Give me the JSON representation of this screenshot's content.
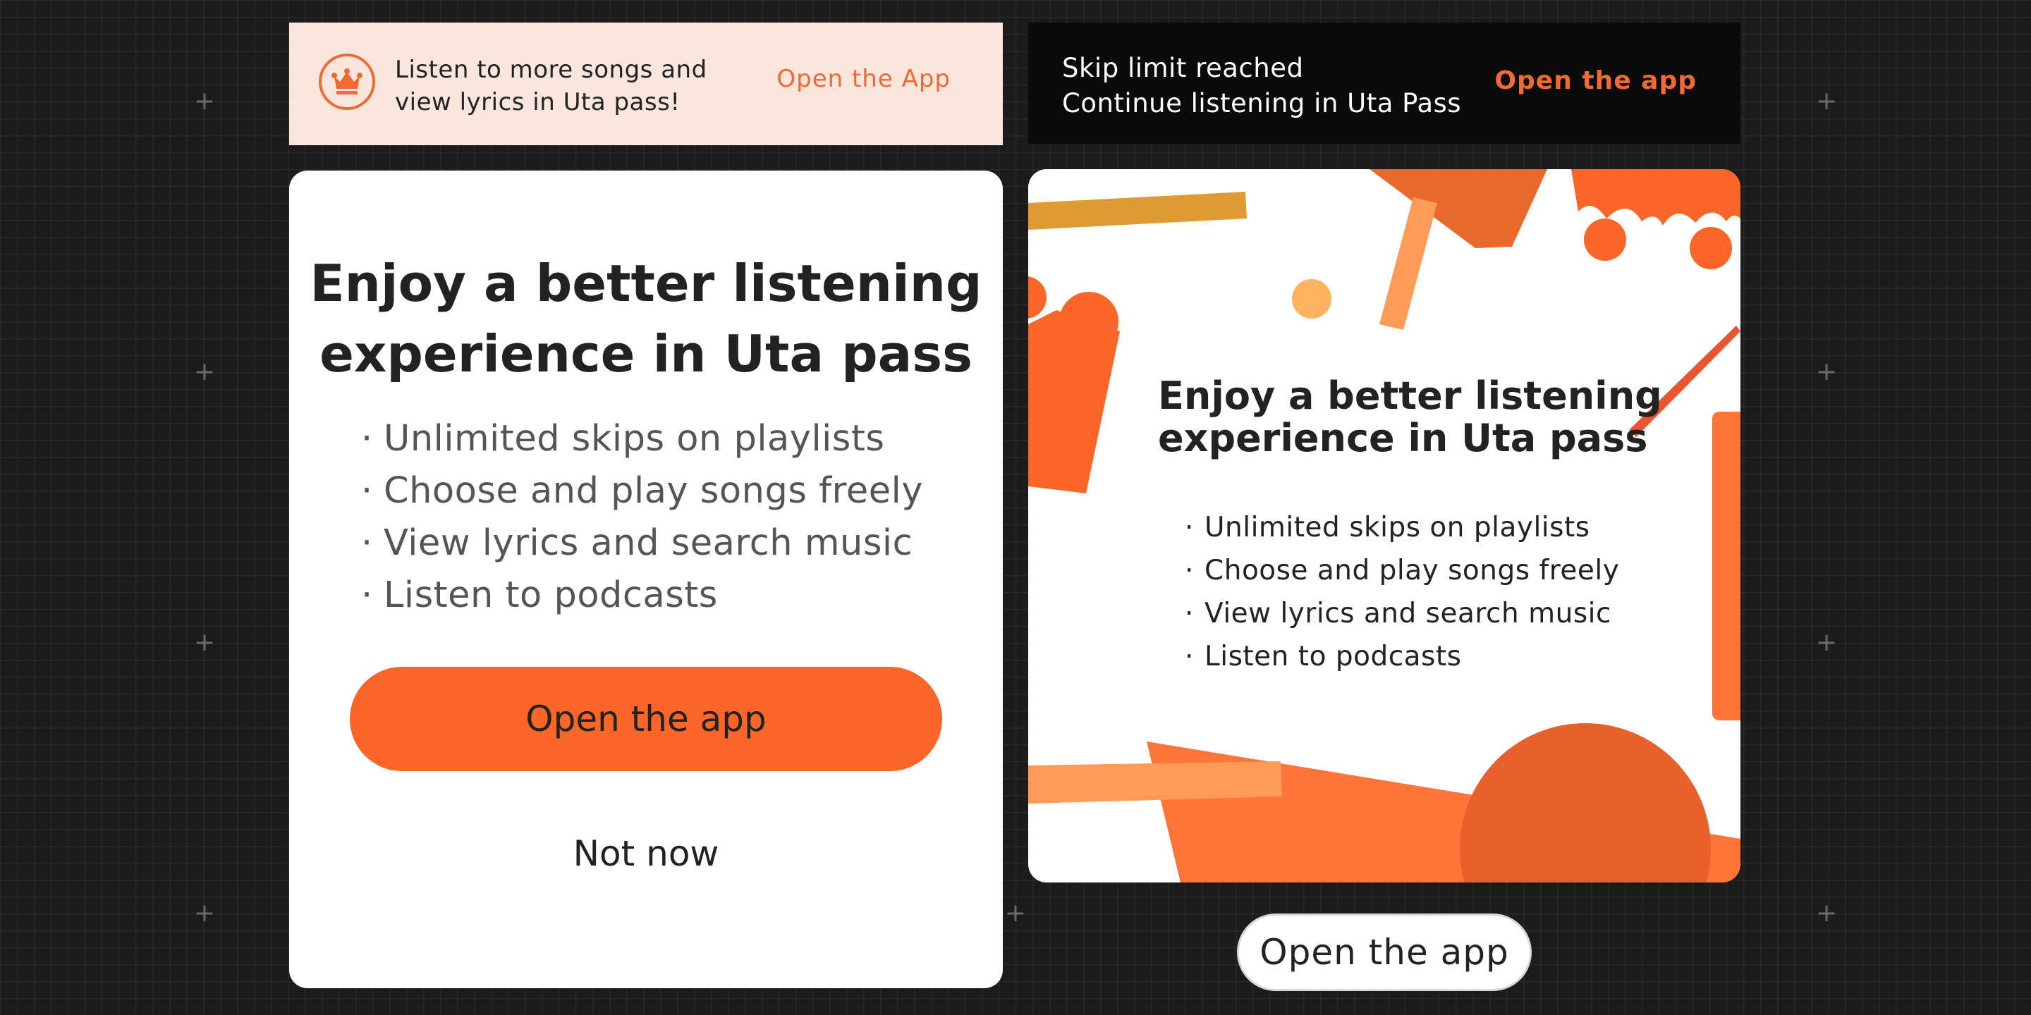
{
  "banner_light": {
    "icon": "crown-icon",
    "message_line1": "Listen to more songs and",
    "message_line2": "view lyrics in Uta pass!",
    "cta": "Open the App"
  },
  "banner_dark": {
    "line1": "Skip limit reached",
    "line2": "Continue listening in Uta Pass",
    "cta": "Open the app"
  },
  "modal_left": {
    "title_line1": "Enjoy a better listening",
    "title_line2": "experience in Uta pass",
    "features": [
      "Unlimited skips on playlists",
      "Choose and play songs freely",
      "View lyrics and search music",
      "Listen to podcasts"
    ],
    "primary_button": "Open the app",
    "secondary_button": "Not now"
  },
  "modal_right": {
    "title_line1": "Enjoy a better listening",
    "title_line2": "experience in Uta pass",
    "features": [
      "Unlimited skips on playlists",
      "Choose and play songs freely",
      "View lyrics and search music",
      "Listen to podcasts"
    ],
    "button": "Open the app"
  },
  "colors": {
    "accent": "#f96627",
    "banner_light_bg": "#fbe6de",
    "banner_dark_bg": "#0a0a0a",
    "page_bg": "#1b1b1b"
  }
}
